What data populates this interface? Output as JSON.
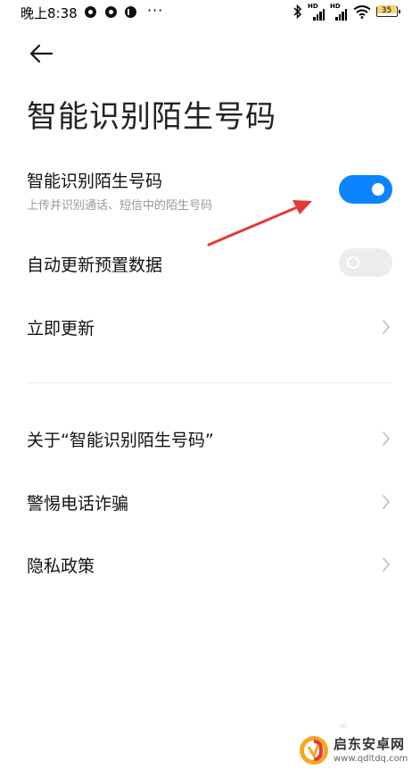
{
  "status_bar": {
    "time": "晚上8:38",
    "more": "···",
    "hd_label": "HD",
    "battery_level": "35"
  },
  "header": {
    "title": "智能识别陌生号码"
  },
  "settings": {
    "smart_identify": {
      "title": "智能识别陌生号码",
      "subtitle": "上传并识别通话、短信中的陌生号码",
      "enabled": true
    },
    "auto_update": {
      "title": "自动更新预置数据",
      "enabled": false
    },
    "update_now": {
      "title": "立即更新"
    }
  },
  "links": {
    "about": "关于“智能识别陌生号码”",
    "fraud_alert": "警惕电话诈骗",
    "privacy": "隐私政策"
  },
  "watermark": {
    "name": "启东安卓网",
    "url": "www.qdltdq.com"
  },
  "colors": {
    "accent": "#0d84ff",
    "toggle_off": "#ececec",
    "annotation": "#e53935"
  }
}
